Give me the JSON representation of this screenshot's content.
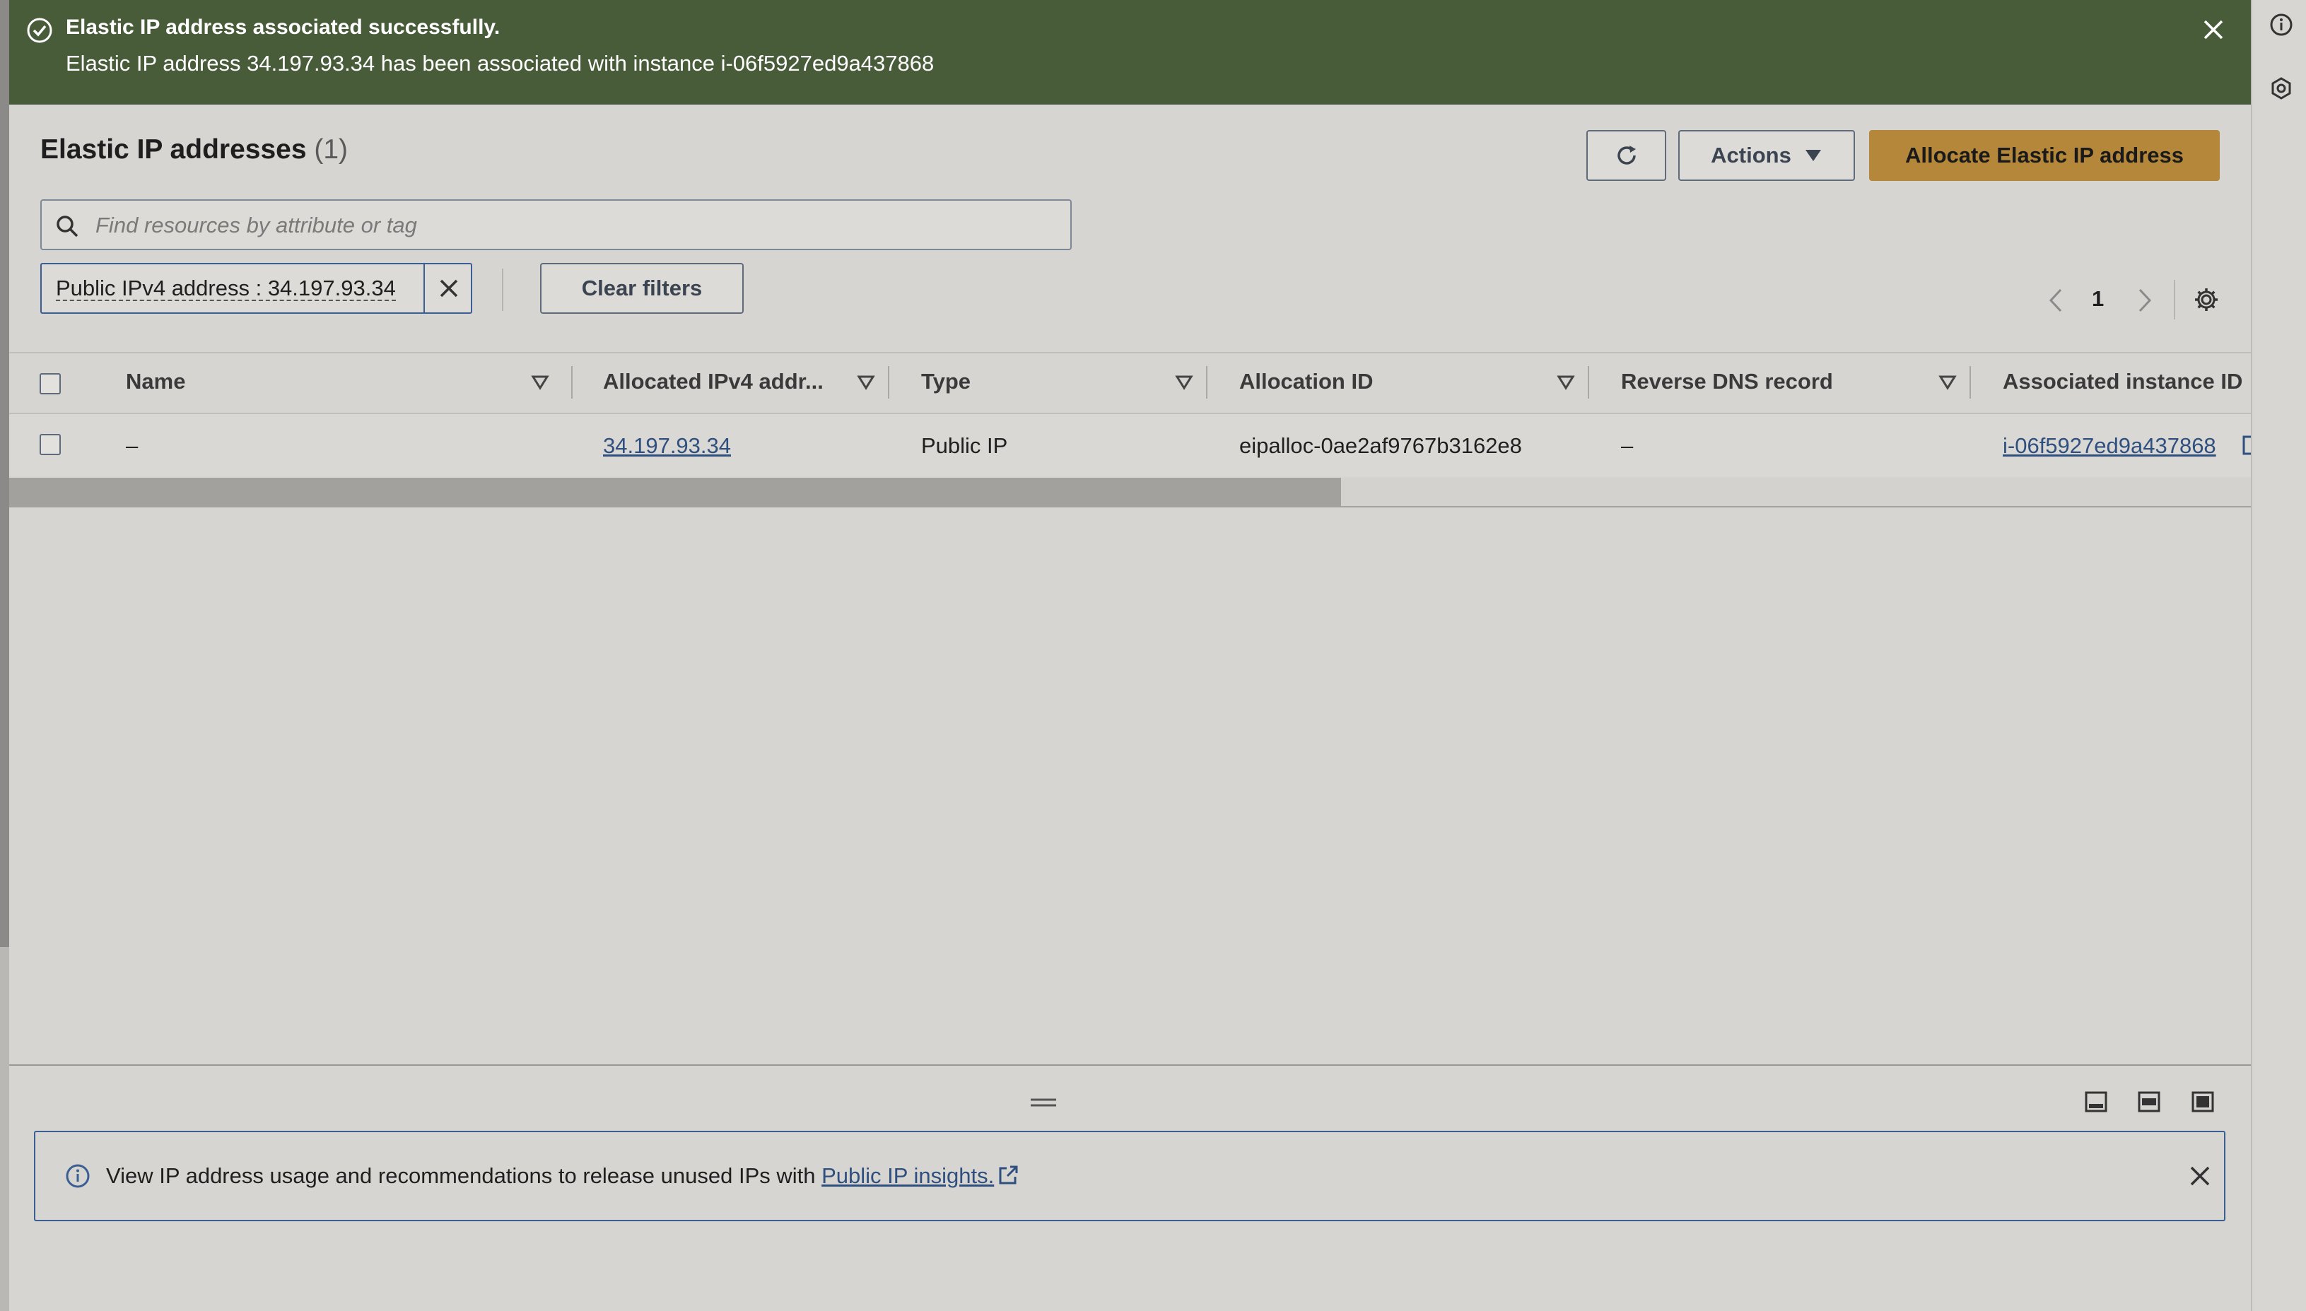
{
  "flash": {
    "title": "Elastic IP address associated successfully.",
    "message": "Elastic IP address 34.197.93.34 has been associated with instance i-06f5927ed9a437868",
    "background": "#485c3a"
  },
  "header": {
    "title": "Elastic IP addresses",
    "count": "(1)",
    "actions_label": "Actions",
    "allocate_label": "Allocate Elastic IP address"
  },
  "search": {
    "placeholder": "Find resources by attribute or tag"
  },
  "filter": {
    "token_label": "Public IPv4 address : 34.197.93.34",
    "clear_label": "Clear filters"
  },
  "pagination": {
    "current_page": "1"
  },
  "table": {
    "columns": [
      "Name",
      "Allocated IPv4 addr...",
      "Type",
      "Allocation ID",
      "Reverse DNS record",
      "Associated instance ID"
    ],
    "rows": [
      {
        "name": "–",
        "ipv4": "34.197.93.34",
        "type": "Public IP",
        "allocation_id": "eipalloc-0ae2af9767b3162e8",
        "reverse_dns": "–",
        "instance_id": "i-06f5927ed9a437868"
      }
    ]
  },
  "info_banner": {
    "text": "View IP address usage and recommendations to release unused IPs with ",
    "link_label": "Public IP insights."
  },
  "colors": {
    "accent": "#b5873a",
    "link": "#2f4f7f",
    "success": "#485c3a"
  }
}
